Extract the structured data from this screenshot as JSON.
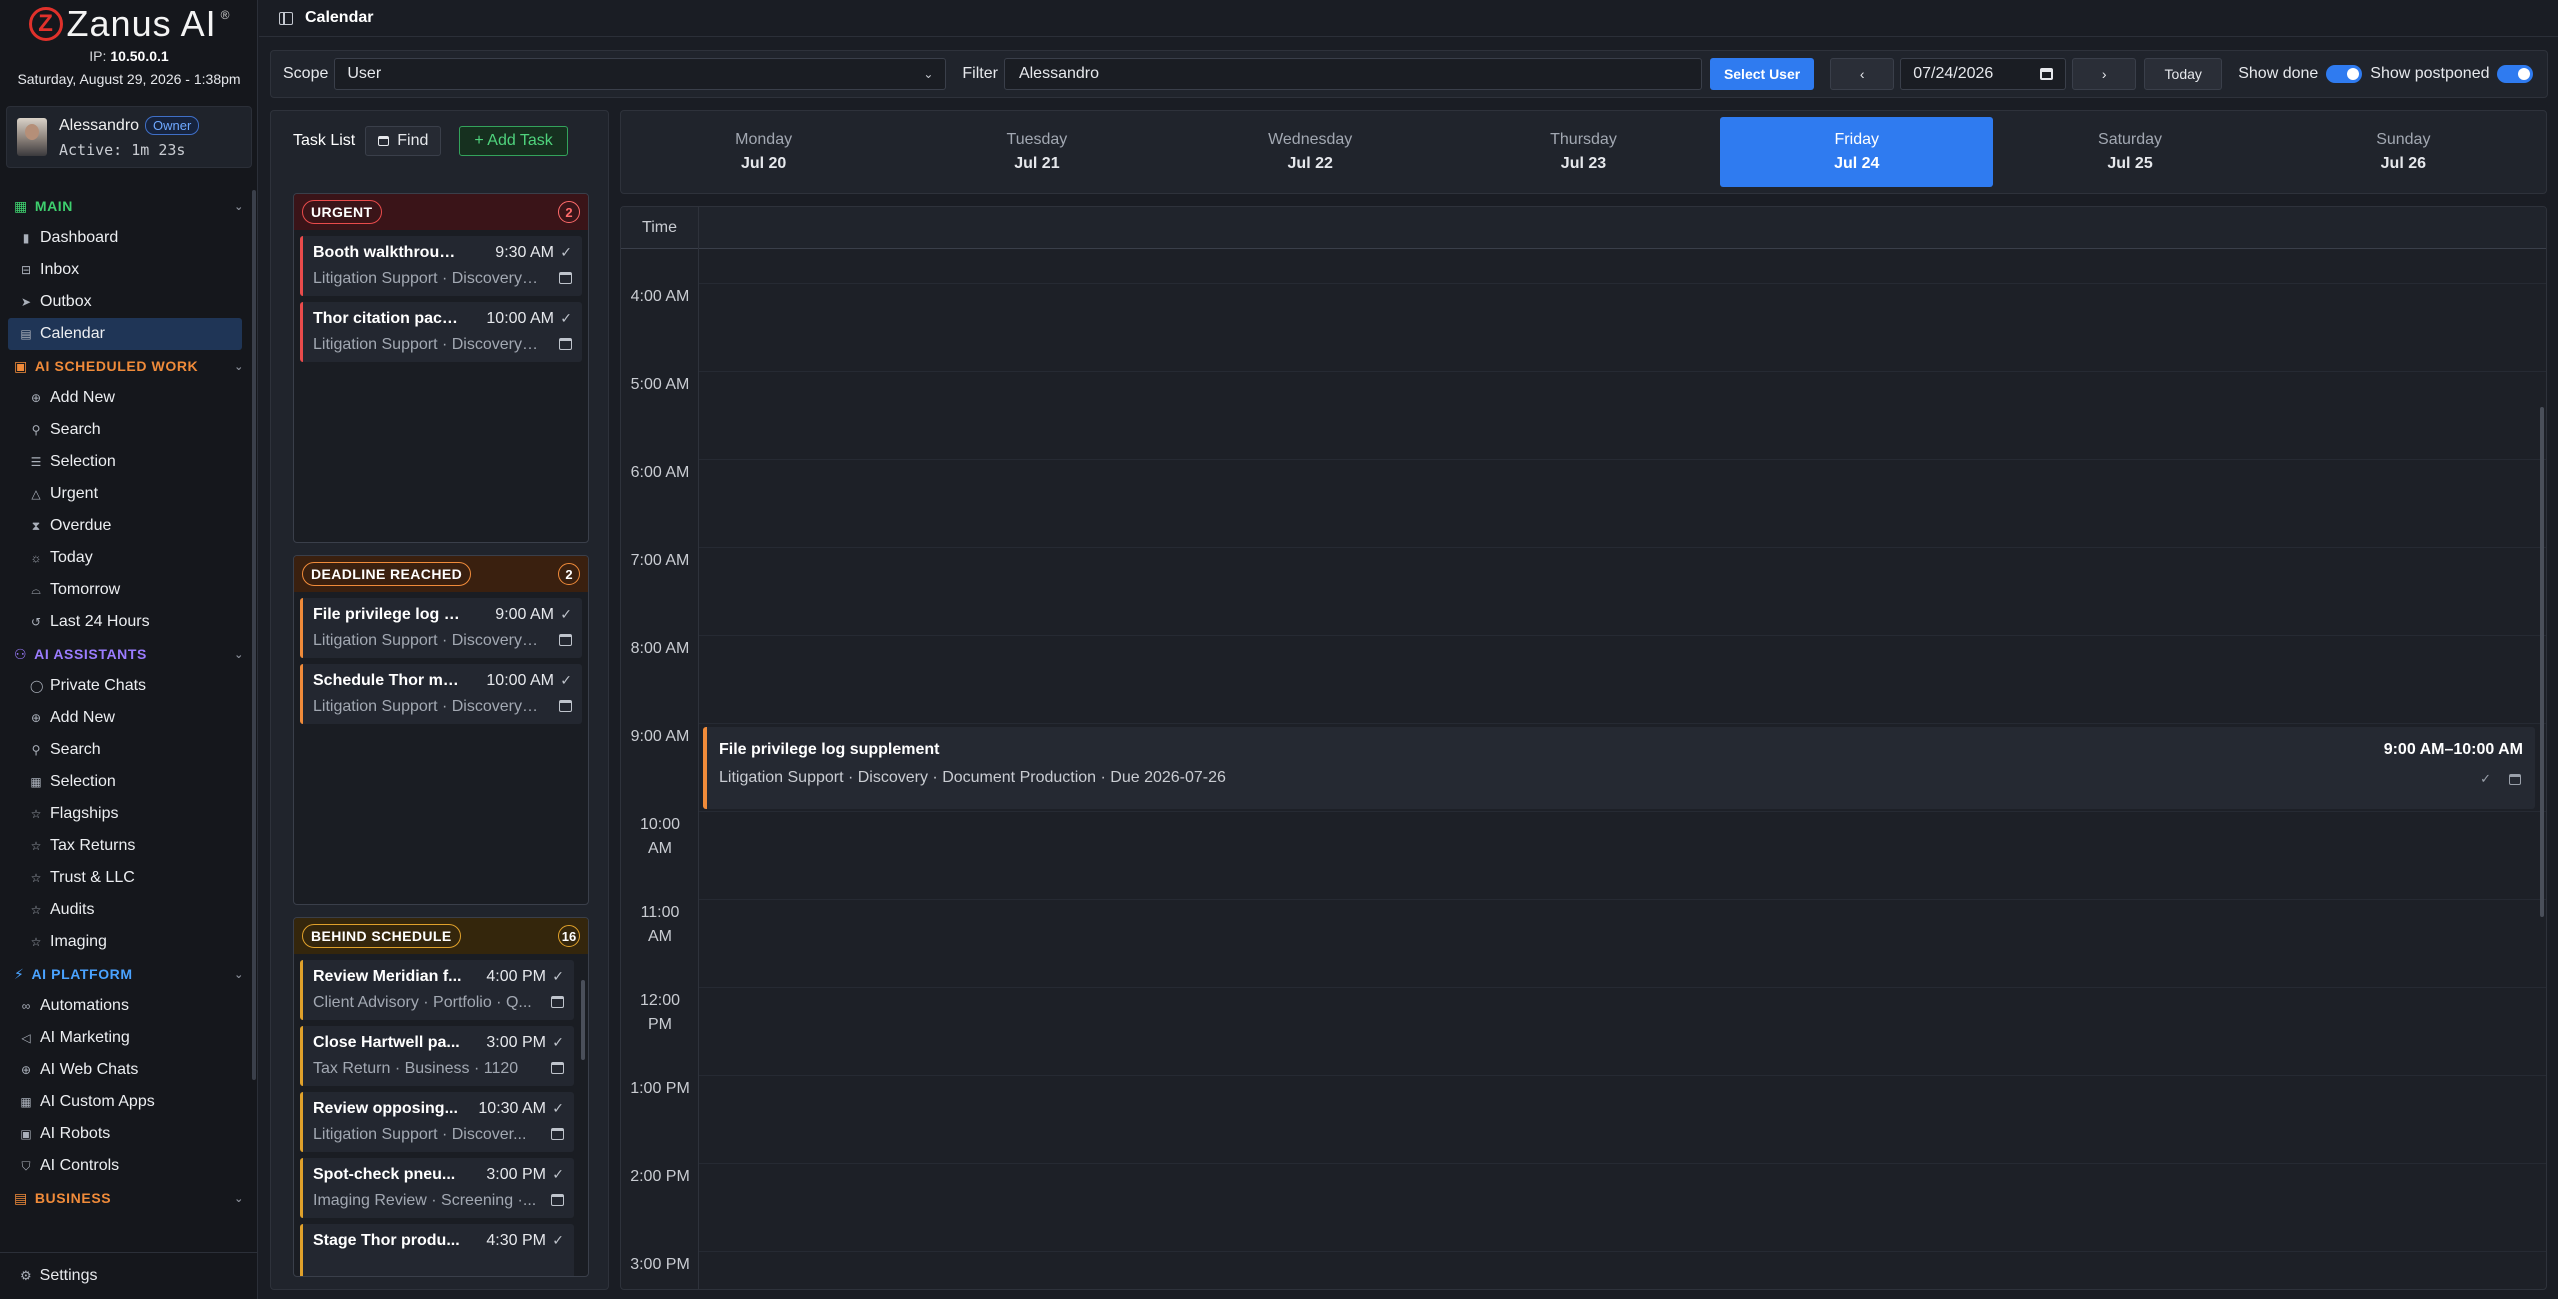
{
  "brand": {
    "name": "Zanus AI",
    "logo_letter": "Z",
    "reg": "®"
  },
  "system": {
    "ip_label": "IP:",
    "ip": "10.50.0.1",
    "datetime": "Saturday, August 29, 2026 - 1:38pm"
  },
  "user": {
    "name": "Alessandro",
    "role": "Owner",
    "active": "Active: 1m 23s"
  },
  "nav": {
    "main": {
      "label": "MAIN",
      "items": [
        "Dashboard",
        "Inbox",
        "Outbox",
        "Calendar"
      ]
    },
    "work": {
      "label": "AI SCHEDULED WORK",
      "items": [
        "Add New",
        "Search",
        "Selection",
        "Urgent",
        "Overdue",
        "Today",
        "Tomorrow",
        "Last 24 Hours"
      ]
    },
    "assistants": {
      "label": "AI ASSISTANTS",
      "items": [
        "Private Chats",
        "Add New",
        "Search",
        "Selection",
        "Flagships",
        "Tax Returns",
        "Trust & LLC",
        "Audits",
        "Imaging"
      ]
    },
    "platform": {
      "label": "AI PLATFORM",
      "items": [
        "Automations",
        "AI Marketing",
        "AI Web Chats",
        "AI Custom Apps",
        "AI Robots",
        "AI Controls"
      ]
    },
    "business": {
      "label": "BUSINESS"
    },
    "settings": "Settings"
  },
  "topbar": {
    "title": "Calendar"
  },
  "filters": {
    "scope_label": "Scope",
    "scope_value": "User",
    "filter_label": "Filter",
    "filter_value": "Alessandro",
    "select_user": "Select User",
    "prev": "‹",
    "date": "07/24/2026",
    "next": "›",
    "today": "Today",
    "show_done": "Show done",
    "show_postponed": "Show postponed"
  },
  "tasklist": {
    "title": "Task List",
    "find": "Find",
    "add_task": "+ Add Task",
    "groups": [
      {
        "label": "URGENT",
        "count": "2",
        "tasks": [
          {
            "title": "Booth walkthrough...",
            "time": "9:30 AM",
            "sub": "Litigation Support · Discovery ..."
          },
          {
            "title": "Thor citation pack...",
            "time": "10:00 AM",
            "sub": "Litigation Support · Discovery ..."
          }
        ]
      },
      {
        "label": "DEADLINE REACHED",
        "count": "2",
        "tasks": [
          {
            "title": "File privilege log s...",
            "time": "9:00 AM",
            "sub": "Litigation Support · Discovery ..."
          },
          {
            "title": "Schedule Thor me...",
            "time": "10:00 AM",
            "sub": "Litigation Support · Discovery ..."
          }
        ]
      },
      {
        "label": "BEHIND SCHEDULE",
        "count": "16",
        "tasks": [
          {
            "title": "Review Meridian f...",
            "time": "4:00 PM",
            "sub": "Client Advisory · Portfolio · Q..."
          },
          {
            "title": "Close Hartwell pa...",
            "time": "3:00 PM",
            "sub": "Tax Return · Business · 1120"
          },
          {
            "title": "Review opposing...",
            "time": "10:30 AM",
            "sub": "Litigation Support · Discover..."
          },
          {
            "title": "Spot-check pneu...",
            "time": "3:00 PM",
            "sub": "Imaging Review · Screening ·..."
          },
          {
            "title": "Stage Thor produ...",
            "time": "4:30 PM",
            "sub": ""
          }
        ]
      }
    ]
  },
  "week": [
    {
      "name": "Monday",
      "date": "Jul 20"
    },
    {
      "name": "Tuesday",
      "date": "Jul 21"
    },
    {
      "name": "Wednesday",
      "date": "Jul 22"
    },
    {
      "name": "Thursday",
      "date": "Jul 23"
    },
    {
      "name": "Friday",
      "date": "Jul 24"
    },
    {
      "name": "Saturday",
      "date": "Jul 25"
    },
    {
      "name": "Sunday",
      "date": "Jul 26"
    }
  ],
  "grid": {
    "time_header": "Time",
    "hours": [
      "4:00 AM",
      "5:00 AM",
      "6:00 AM",
      "7:00 AM",
      "8:00 AM",
      "9:00 AM",
      "10:00 AM",
      "11:00 AM",
      "12:00 PM",
      "1:00 PM",
      "2:00 PM",
      "3:00 PM"
    ],
    "event": {
      "title": "File privilege log supplement",
      "sub": "Litigation Support · Discovery · Document Production · Due 2026-07-26",
      "time": "9:00 AM–10:00 AM"
    }
  },
  "colors": {
    "accent": "#2f7bf0",
    "urgent": "#e94b4b",
    "deadline": "#f08b3a",
    "behind": "#e0a12b",
    "add": "#4fd37d"
  }
}
